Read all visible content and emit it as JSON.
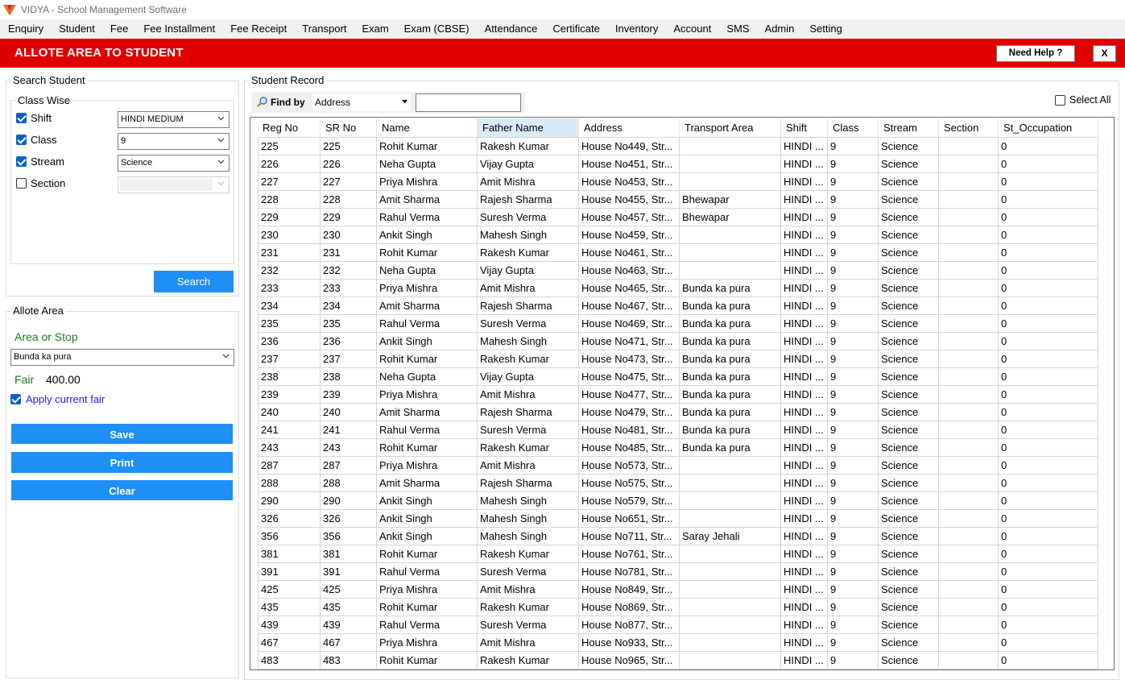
{
  "window": {
    "title": "VIDYA - School Management Software"
  },
  "menu": [
    "Enquiry",
    "Student",
    "Fee",
    "Fee Installment",
    "Fee Receipt",
    "Transport",
    "Exam",
    "Exam (CBSE)",
    "Attendance",
    "Certificate",
    "Inventory",
    "Account",
    "SMS",
    "Admin",
    "Setting"
  ],
  "header": {
    "title": "ALLOTE AREA TO STUDENT",
    "help_label": "Need Help ?",
    "close_label": "X"
  },
  "search_student": {
    "label": "Search Student",
    "class_wise_label": "Class Wise",
    "shift": {
      "label": "Shift",
      "checked": true,
      "value": "HINDI MEDIUM"
    },
    "class": {
      "label": "Class",
      "checked": true,
      "value": "9"
    },
    "stream": {
      "label": "Stream",
      "checked": true,
      "value": "Science"
    },
    "section": {
      "label": "Section",
      "checked": false,
      "value": ""
    },
    "search_label": "Search"
  },
  "allote_area": {
    "label": "Allote Area",
    "area_label": "Area or Stop",
    "area_value": "Bunda ka pura",
    "fair_label": "Fair",
    "fair_value": "400.00",
    "apply_label": "Apply current fair",
    "apply_checked": true,
    "save_label": "Save",
    "print_label": "Print",
    "clear_label": "Clear"
  },
  "student_record": {
    "label": "Student Record",
    "find_by_label": "Find by",
    "find_by_value": "Address",
    "search_value": "",
    "select_all_label": "Select All",
    "columns": [
      "Reg No",
      "SR No",
      "Name",
      "Father Name",
      "Address",
      "Transport Area",
      "Shift",
      "Class",
      "Stream",
      "Section",
      "St_Occupation"
    ],
    "rows": [
      [
        "225",
        "225",
        "Rohit Kumar",
        "Rakesh Kumar",
        "House No449, Str...",
        "",
        "HINDI ...",
        "9",
        "Science",
        "",
        "0"
      ],
      [
        "226",
        "226",
        "Neha Gupta",
        "Vijay Gupta",
        "House No451, Str...",
        "",
        "HINDI ...",
        "9",
        "Science",
        "",
        "0"
      ],
      [
        "227",
        "227",
        "Priya Mishra",
        "Amit Mishra",
        "House No453, Str...",
        "",
        "HINDI ...",
        "9",
        "Science",
        "",
        "0"
      ],
      [
        "228",
        "228",
        "Amit Sharma",
        "Rajesh Sharma",
        "House No455, Str...",
        "Bhewapar",
        "HINDI ...",
        "9",
        "Science",
        "",
        "0"
      ],
      [
        "229",
        "229",
        "Rahul Verma",
        "Suresh Verma",
        "House No457, Str...",
        "Bhewapar",
        "HINDI ...",
        "9",
        "Science",
        "",
        "0"
      ],
      [
        "230",
        "230",
        "Ankit Singh",
        "Mahesh Singh",
        "House No459, Str...",
        "",
        "HINDI ...",
        "9",
        "Science",
        "",
        "0"
      ],
      [
        "231",
        "231",
        "Rohit Kumar",
        "Rakesh Kumar",
        "House No461, Str...",
        "",
        "HINDI ...",
        "9",
        "Science",
        "",
        "0"
      ],
      [
        "232",
        "232",
        "Neha Gupta",
        "Vijay Gupta",
        "House No463, Str...",
        "",
        "HINDI ...",
        "9",
        "Science",
        "",
        "0"
      ],
      [
        "233",
        "233",
        "Priya Mishra",
        "Amit Mishra",
        "House No465, Str...",
        "Bunda ka pura",
        "HINDI ...",
        "9",
        "Science",
        "",
        "0"
      ],
      [
        "234",
        "234",
        "Amit Sharma",
        "Rajesh Sharma",
        "House No467, Str...",
        "Bunda ka pura",
        "HINDI ...",
        "9",
        "Science",
        "",
        "0"
      ],
      [
        "235",
        "235",
        "Rahul Verma",
        "Suresh Verma",
        "House No469, Str...",
        "Bunda ka pura",
        "HINDI ...",
        "9",
        "Science",
        "",
        "0"
      ],
      [
        "236",
        "236",
        "Ankit Singh",
        "Mahesh Singh",
        "House No471, Str...",
        "Bunda ka pura",
        "HINDI ...",
        "9",
        "Science",
        "",
        "0"
      ],
      [
        "237",
        "237",
        "Rohit Kumar",
        "Rakesh Kumar",
        "House No473, Str...",
        "Bunda ka pura",
        "HINDI ...",
        "9",
        "Science",
        "",
        "0"
      ],
      [
        "238",
        "238",
        "Neha Gupta",
        "Vijay Gupta",
        "House No475, Str...",
        "Bunda ka pura",
        "HINDI ...",
        "9",
        "Science",
        "",
        "0"
      ],
      [
        "239",
        "239",
        "Priya Mishra",
        "Amit Mishra",
        "House No477, Str...",
        "Bunda ka pura",
        "HINDI ...",
        "9",
        "Science",
        "",
        "0"
      ],
      [
        "240",
        "240",
        "Amit Sharma",
        "Rajesh Sharma",
        "House No479, Str...",
        "Bunda ka pura",
        "HINDI ...",
        "9",
        "Science",
        "",
        "0"
      ],
      [
        "241",
        "241",
        "Rahul Verma",
        "Suresh Verma",
        "House No481, Str...",
        "Bunda ka pura",
        "HINDI ...",
        "9",
        "Science",
        "",
        "0"
      ],
      [
        "243",
        "243",
        "Rohit Kumar",
        "Rakesh Kumar",
        "House No485, Str...",
        "Bunda ka pura",
        "HINDI ...",
        "9",
        "Science",
        "",
        "0"
      ],
      [
        "287",
        "287",
        "Priya Mishra",
        "Amit Mishra",
        "House No573, Str...",
        "",
        "HINDI ...",
        "9",
        "Science",
        "",
        "0"
      ],
      [
        "288",
        "288",
        "Amit Sharma",
        "Rajesh Sharma",
        "House No575, Str...",
        "",
        "HINDI ...",
        "9",
        "Science",
        "",
        "0"
      ],
      [
        "290",
        "290",
        "Ankit Singh",
        "Mahesh Singh",
        "House No579, Str...",
        "",
        "HINDI ...",
        "9",
        "Science",
        "",
        "0"
      ],
      [
        "326",
        "326",
        "Ankit Singh",
        "Mahesh Singh",
        "House No651, Str...",
        "",
        "HINDI ...",
        "9",
        "Science",
        "",
        "0"
      ],
      [
        "356",
        "356",
        "Ankit Singh",
        "Mahesh Singh",
        "House No711, Str...",
        "Saray Jehali",
        "HINDI ...",
        "9",
        "Science",
        "",
        "0"
      ],
      [
        "381",
        "381",
        "Rohit Kumar",
        "Rakesh Kumar",
        "House No761, Str...",
        "",
        "HINDI ...",
        "9",
        "Science",
        "",
        "0"
      ],
      [
        "391",
        "391",
        "Rahul Verma",
        "Suresh Verma",
        "House No781, Str...",
        "",
        "HINDI ...",
        "9",
        "Science",
        "",
        "0"
      ],
      [
        "425",
        "425",
        "Priya Mishra",
        "Amit Mishra",
        "House No849, Str...",
        "",
        "HINDI ...",
        "9",
        "Science",
        "",
        "0"
      ],
      [
        "435",
        "435",
        "Rohit Kumar",
        "Rakesh Kumar",
        "House No869, Str...",
        "",
        "HINDI ...",
        "9",
        "Science",
        "",
        "0"
      ],
      [
        "439",
        "439",
        "Rahul Verma",
        "Suresh Verma",
        "House No877, Str...",
        "",
        "HINDI ...",
        "9",
        "Science",
        "",
        "0"
      ],
      [
        "467",
        "467",
        "Priya Mishra",
        "Amit Mishra",
        "House No933, Str...",
        "",
        "HINDI ...",
        "9",
        "Science",
        "",
        "0"
      ],
      [
        "483",
        "483",
        "Rohit Kumar",
        "Rakesh Kumar",
        "House No965, Str...",
        "",
        "HINDI ...",
        "9",
        "Science",
        "",
        "0"
      ]
    ]
  },
  "colors": {
    "header_red": "#e00000",
    "button_blue": "#1e8ff5",
    "checkbox_blue": "#0a64c8",
    "label_green": "#1a7a1a",
    "link_blue": "#1a1aff"
  }
}
